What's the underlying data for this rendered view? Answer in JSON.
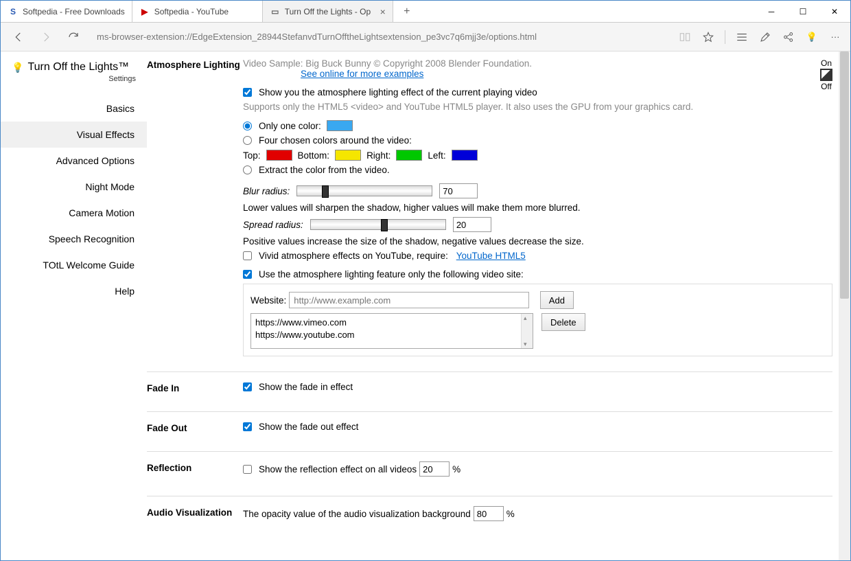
{
  "tabs": [
    {
      "title": "Softpedia - Free Downloads",
      "favicon": "S",
      "faviconColor": "#2a5ab3"
    },
    {
      "title": "Softpedia - YouTube",
      "favicon": "▶",
      "faviconColor": "#cc0000"
    },
    {
      "title": "Turn Off the Lights - Op",
      "favicon": "▭",
      "faviconColor": "#666",
      "active": true
    }
  ],
  "url": "ms-browser-extension://EdgeExtension_28944StefanvdTurnOfftheLightsextension_pe3vc7q6mjj3e/options.html",
  "app": {
    "name": "Turn Off the Lights™",
    "subtitle": "Settings"
  },
  "nav": [
    "Basics",
    "Visual Effects",
    "Advanced Options",
    "Night Mode",
    "Camera Motion",
    "Speech Recognition",
    "TOtL Welcome Guide",
    "Help"
  ],
  "navActive": 1,
  "atmosphere": {
    "heading": "Atmosphere Lighting",
    "sample": "Video Sample: Big Buck Bunny © Copyright 2008 Blender Foundation.",
    "seeOnline": "See online for more examples",
    "on": "On",
    "off": "Off",
    "showEffect": "Show you the atmosphere lighting effect of the current playing video",
    "supports": "Supports only the HTML5 <video> and YouTube HTML5 player. It also uses the GPU from your graphics card.",
    "onlyOne": "Only one color:",
    "oneColor": "#3aa8f0",
    "fourColors": "Four chosen colors around the video:",
    "topLabel": "Top:",
    "bottomLabel": "Bottom:",
    "rightLabel": "Right:",
    "leftLabel": "Left:",
    "topColor": "#e10000",
    "bottomColor": "#f5e600",
    "rightColor": "#00c800",
    "leftColor": "#0000d8",
    "extract": "Extract the color from the video.",
    "blurLabel": "Blur radius:",
    "blurValue": "70",
    "blurDesc": "Lower values will sharpen the shadow, higher values will make them more blurred.",
    "spreadLabel": "Spread radius:",
    "spreadValue": "20",
    "spreadDesc": "Positive values increase the size of the shadow, negative values decrease the size.",
    "vivid": "Vivid atmosphere effects on YouTube, require:",
    "vividLink": "YouTube HTML5",
    "siteOnly": "Use the atmosphere lighting feature only the following video site:",
    "websiteLabel": "Website:",
    "websitePlaceholder": "http://www.example.com",
    "addBtn": "Add",
    "deleteBtn": "Delete",
    "sites": [
      "https://www.vimeo.com",
      "https://www.youtube.com"
    ]
  },
  "fadeIn": {
    "heading": "Fade In",
    "label": "Show the fade in effect"
  },
  "fadeOut": {
    "heading": "Fade Out",
    "label": "Show the fade out effect"
  },
  "reflection": {
    "heading": "Reflection",
    "label": "Show the reflection effect on all videos",
    "value": "20",
    "pct": "%"
  },
  "audio": {
    "heading": "Audio Visualization",
    "label": "The opacity value of the audio visualization background",
    "value": "80",
    "pct": "%"
  }
}
